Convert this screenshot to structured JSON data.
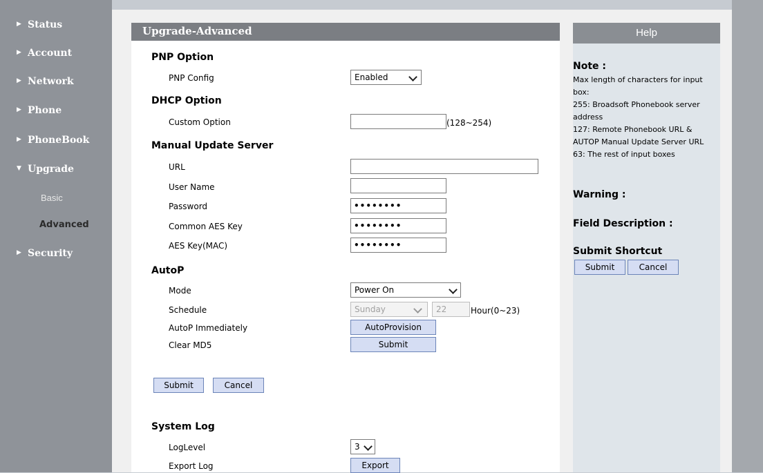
{
  "sidebar": {
    "items": [
      {
        "label": "Status"
      },
      {
        "label": "Account"
      },
      {
        "label": "Network"
      },
      {
        "label": "Phone"
      },
      {
        "label": "PhoneBook"
      },
      {
        "label": "Upgrade"
      },
      {
        "label": "Security"
      }
    ],
    "subitems": [
      {
        "label": "Basic"
      },
      {
        "label": "Advanced"
      }
    ]
  },
  "panel": {
    "title": "Upgrade-Advanced"
  },
  "pnp": {
    "title": "PNP Option",
    "config_label": "PNP Config",
    "config_value": "Enabled"
  },
  "dhcp": {
    "title": "DHCP Option",
    "custom_label": "Custom Option",
    "custom_value": "",
    "custom_hint": "(128~254)"
  },
  "manual": {
    "title": "Manual Update Server",
    "url_label": "URL",
    "url_value": "",
    "username_label": "User Name",
    "username_value": "",
    "password_label": "Password",
    "password_value": "••••••••",
    "common_aes_label": "Common AES Key",
    "common_aes_value": "••••••••",
    "aes_mac_label": "AES Key(MAC)",
    "aes_mac_value": "••••••••"
  },
  "autop": {
    "title": "AutoP",
    "mode_label": "Mode",
    "mode_value": "Power On",
    "schedule_label": "Schedule",
    "schedule_day": "Sunday",
    "schedule_hour": "22",
    "schedule_hint": "Hour(0~23)",
    "immediately_label": "AutoP Immediately",
    "autoprovision_button": "AutoProvision",
    "clear_md5_label": "Clear MD5",
    "clear_md5_button": "Submit"
  },
  "form_buttons": {
    "submit": "Submit",
    "cancel": "Cancel"
  },
  "syslog": {
    "title": "System Log",
    "loglevel_label": "LogLevel",
    "loglevel_value": "3",
    "export_label": "Export Log",
    "export_button": "Export"
  },
  "help": {
    "title": "Help",
    "note_heading": "Note :",
    "note_lines": [
      "Max length of characters for input",
      "box:",
      "255: Broadsoft Phonebook server",
      "address",
      "127: Remote Phonebook URL &",
      "AUTOP Manual Update Server URL",
      "63: The rest of input boxes"
    ],
    "warning_heading": "Warning :",
    "field_desc_heading": "Field Description :",
    "shortcut_heading": "Submit Shortcut",
    "submit_button": "Submit",
    "cancel_button": "Cancel"
  }
}
